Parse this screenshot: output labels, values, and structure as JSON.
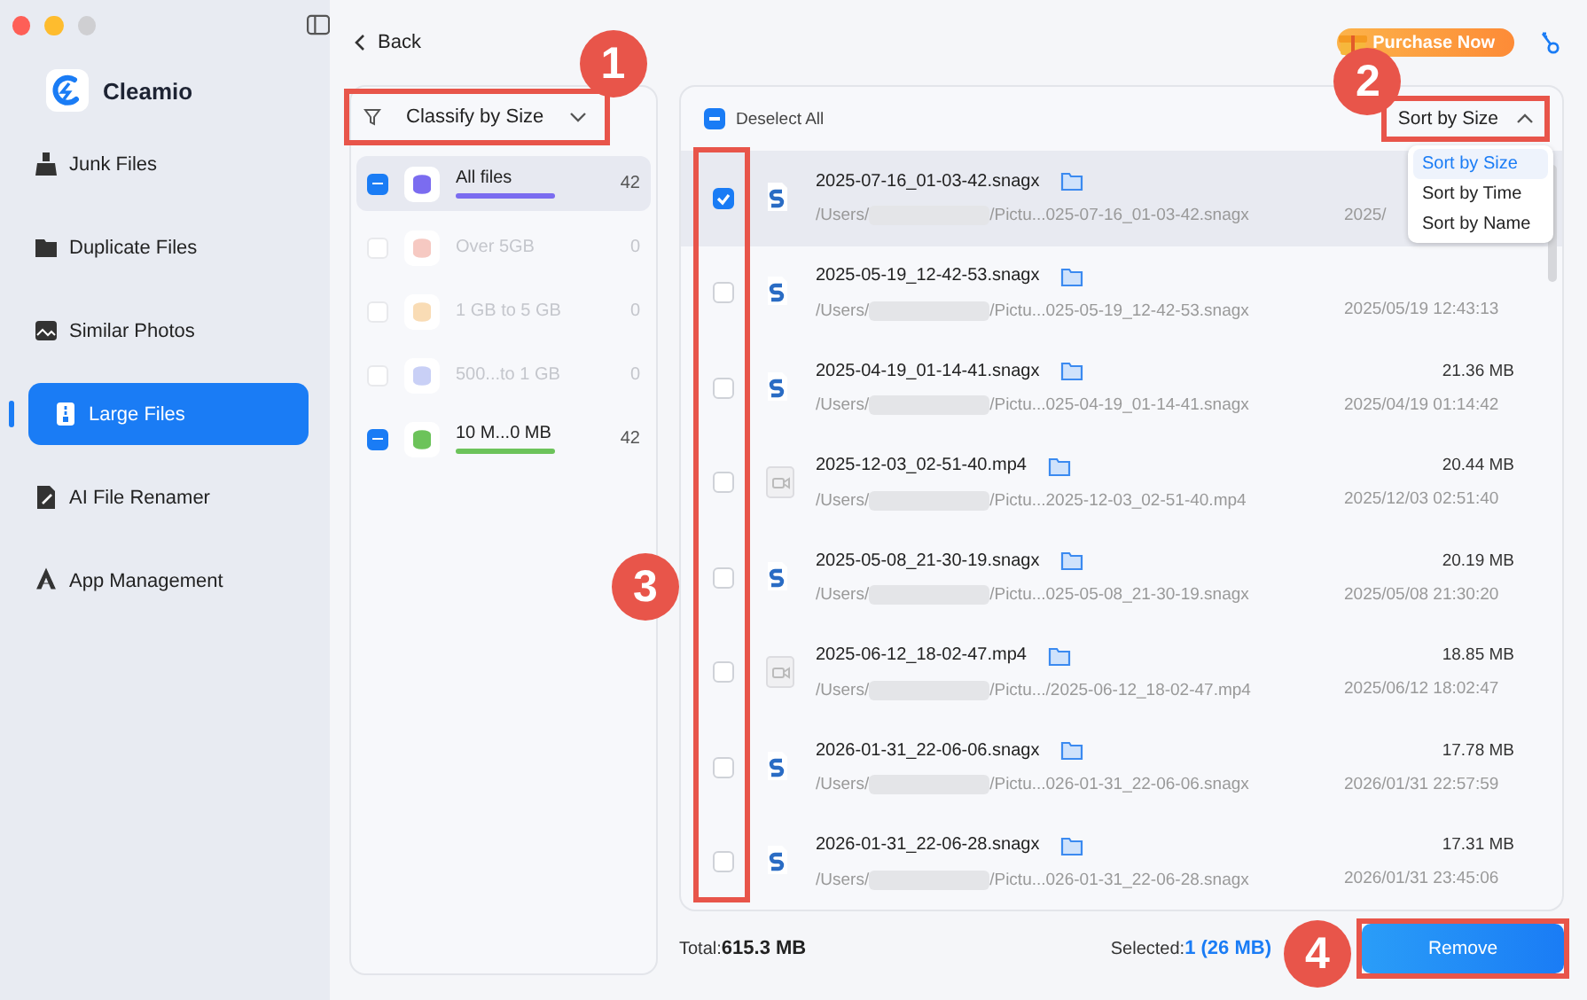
{
  "sidebar": {
    "app_name": "Cleamio",
    "items": [
      {
        "label": "Junk Files",
        "selected": false
      },
      {
        "label": "Duplicate Files",
        "selected": false
      },
      {
        "label": "Similar Photos",
        "selected": false
      },
      {
        "label": "Large Files",
        "selected": true
      },
      {
        "label": "AI File Renamer",
        "selected": false
      },
      {
        "label": "App Management",
        "selected": false
      }
    ]
  },
  "header": {
    "back": "Back",
    "purchase": "Purchase Now"
  },
  "categories": {
    "classify": "Classify by Size",
    "items": [
      {
        "label": "All files",
        "count": "42",
        "checked": true,
        "disabled": false,
        "selected": true,
        "color": "#7b6cf0"
      },
      {
        "label": "Over 5GB",
        "count": "0",
        "checked": false,
        "disabled": true,
        "selected": false,
        "color": "#f6c9c2"
      },
      {
        "label": "1 GB to 5 GB",
        "count": "0",
        "checked": false,
        "disabled": true,
        "selected": false,
        "color": "#f9dcb5"
      },
      {
        "label": "500...to 1 GB",
        "count": "0",
        "checked": false,
        "disabled": true,
        "selected": false,
        "color": "#c9d0f6"
      },
      {
        "label": "10 M...0 MB",
        "count": "42",
        "checked": true,
        "disabled": false,
        "selected": false,
        "color": "#6cc35a"
      }
    ]
  },
  "files": {
    "deselect_all": {
      "label": "Deselect All",
      "checked": true
    },
    "sort": {
      "label": "Sort by Size",
      "expanded": true,
      "options": [
        {
          "label": "Sort by Size",
          "selected": true
        },
        {
          "label": "Sort by Time",
          "selected": false
        },
        {
          "label": "Sort by Name",
          "selected": false
        }
      ]
    },
    "rows": [
      {
        "name": "2025-07-16_01-03-42.snagx",
        "kind": "snagx",
        "path_start": "/Users/",
        "path_end": "/Pictu...025-07-16_01-03-42.snagx",
        "date": "2025/",
        "checked": true,
        "selected": true
      },
      {
        "name": "2025-05-19_12-42-53.snagx",
        "kind": "snagx",
        "path_start": "/Users/",
        "path_end": "/Pictu...025-05-19_12-42-53.snagx",
        "date": "2025/05/19 12:43:13",
        "checked": false,
        "selected": false
      },
      {
        "name": "2025-04-19_01-14-41.snagx",
        "kind": "snagx",
        "path_start": "/Users/",
        "path_end": "/Pictu...025-04-19_01-14-41.snagx",
        "size": "21.36  MB",
        "date": "2025/04/19 01:14:42",
        "checked": false,
        "selected": false
      },
      {
        "name": "2025-12-03_02-51-40.mp4",
        "kind": "video",
        "path_start": "/Users/",
        "path_end": "/Pictu...2025-12-03_02-51-40.mp4",
        "size": "20.44  MB",
        "date": "2025/12/03 02:51:40",
        "checked": false,
        "selected": false
      },
      {
        "name": "2025-05-08_21-30-19.snagx",
        "kind": "snagx",
        "path_start": "/Users/",
        "path_end": "/Pictu...025-05-08_21-30-19.snagx",
        "size": "20.19  MB",
        "date": "2025/05/08 21:30:20",
        "checked": false,
        "selected": false
      },
      {
        "name": "2025-06-12_18-02-47.mp4",
        "kind": "video",
        "path_start": "/Users/",
        "path_end": "/Pictu.../2025-06-12_18-02-47.mp4",
        "size": "18.85  MB",
        "date": "2025/06/12 18:02:47",
        "checked": false,
        "selected": false
      },
      {
        "name": "2026-01-31_22-06-06.snagx",
        "kind": "snagx",
        "path_start": "/Users/",
        "path_end": "/Pictu...026-01-31_22-06-06.snagx",
        "size": "17.78  MB",
        "date": "2026/01/31 22:57:59",
        "checked": false,
        "selected": false
      },
      {
        "name": "2026-01-31_22-06-28.snagx",
        "kind": "snagx",
        "path_start": "/Users/",
        "path_end": "/Pictu...026-01-31_22-06-28.snagx",
        "size": "17.31  MB",
        "date": "2026/01/31 23:45:06",
        "checked": false,
        "selected": false
      }
    ]
  },
  "footer": {
    "total_label": "Total:",
    "total": "615.3 MB",
    "selected_label": "Selected:",
    "selected": "1 (26  MB)",
    "remove": "Remove"
  },
  "annotations": [
    {
      "number": "1"
    },
    {
      "number": "2"
    },
    {
      "number": "3"
    },
    {
      "number": "4"
    }
  ]
}
